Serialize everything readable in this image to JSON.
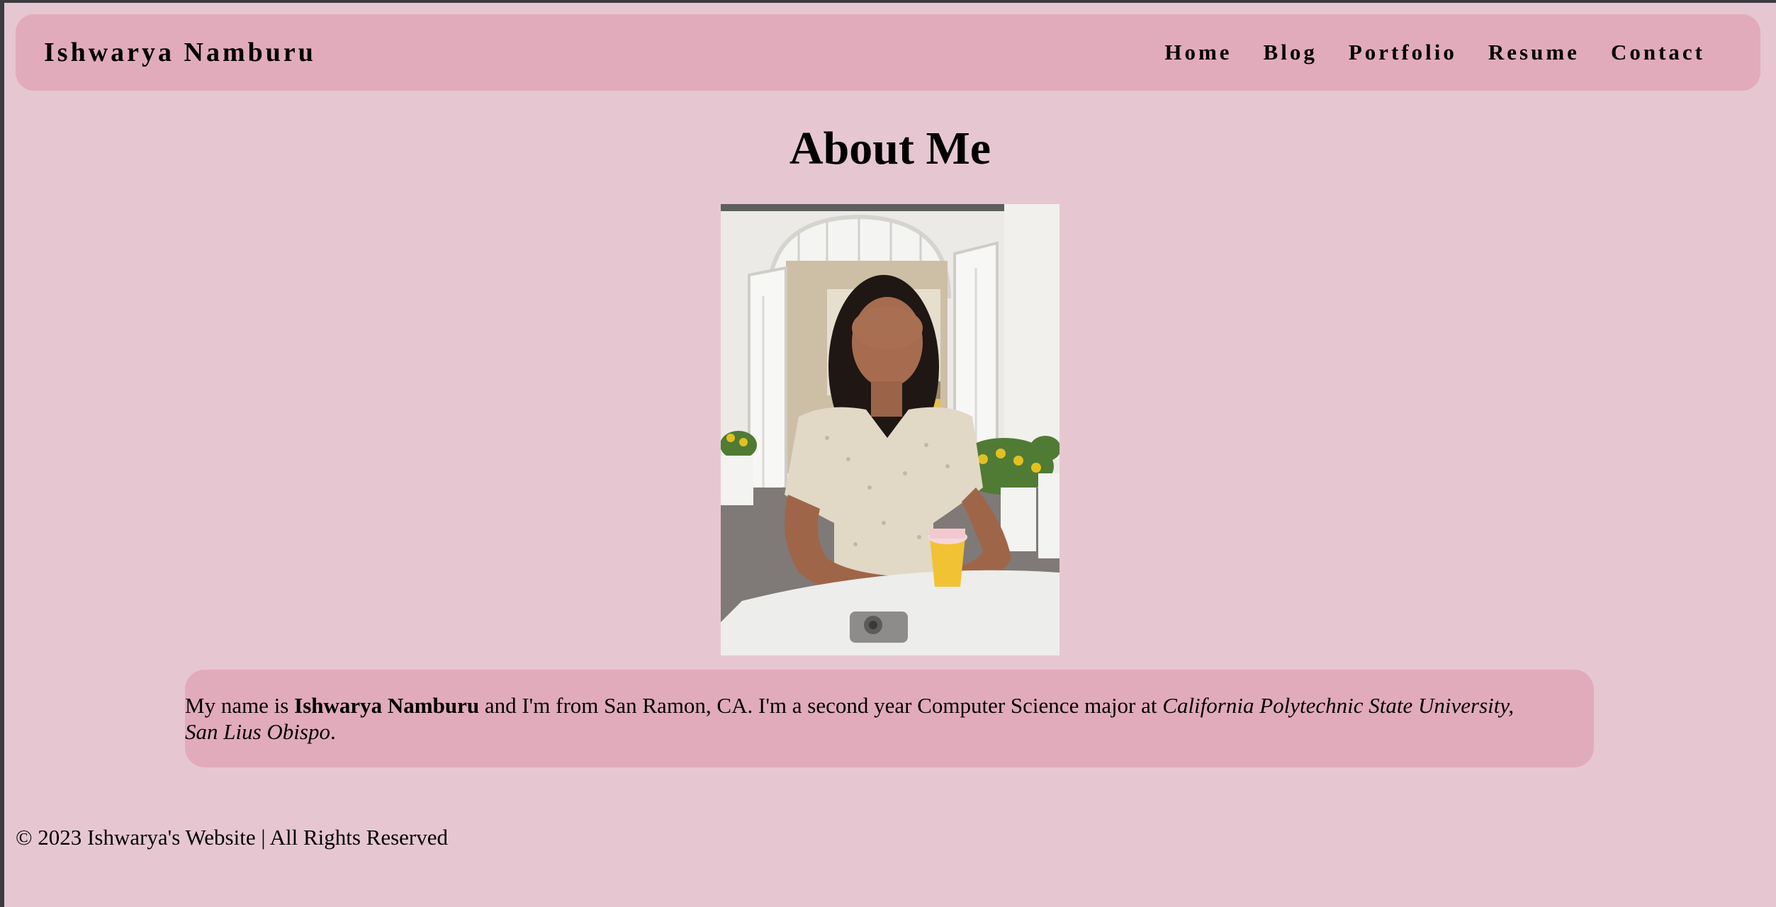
{
  "header": {
    "brand": "Ishwarya Namburu",
    "nav": [
      "Home",
      "Blog",
      "Portfolio",
      "Resume",
      "Contact"
    ]
  },
  "main": {
    "title": "About Me",
    "photo_alt": "Photo of Ishwarya Namburu",
    "bio": {
      "part1": "My name is ",
      "name": "Ishwarya Namburu",
      "part2": " and I'm from San Ramon, CA. I'm a second year Computer Science major at ",
      "school_line1": "California Polytechnic State University,",
      "school_line2": "San Lius Obispo",
      "end": "."
    }
  },
  "footer": {
    "text": "© 2023 Ishwarya's Website | All Rights Reserved"
  },
  "colors": {
    "page_background": "#e6c7d1",
    "panel_background": "#e1abbb",
    "text": "#000000"
  }
}
